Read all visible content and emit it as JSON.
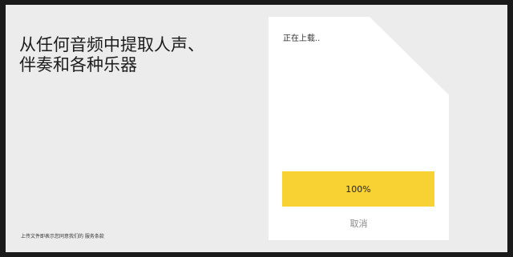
{
  "page": {
    "headline_line1": "从任何音频中提取人声、",
    "headline_line2": "伴奏和各种乐器",
    "terms_text": "上传文件即表示您同意我们的 服务条款"
  },
  "upload_card": {
    "status_text": "正在上载..",
    "progress_percent": 100,
    "progress_label": "100%",
    "cancel_label": "取消"
  },
  "colors": {
    "background": "#ececec",
    "card": "#ffffff",
    "progress_accent": "#f8d232",
    "frame_border": "#1a1a1a"
  }
}
